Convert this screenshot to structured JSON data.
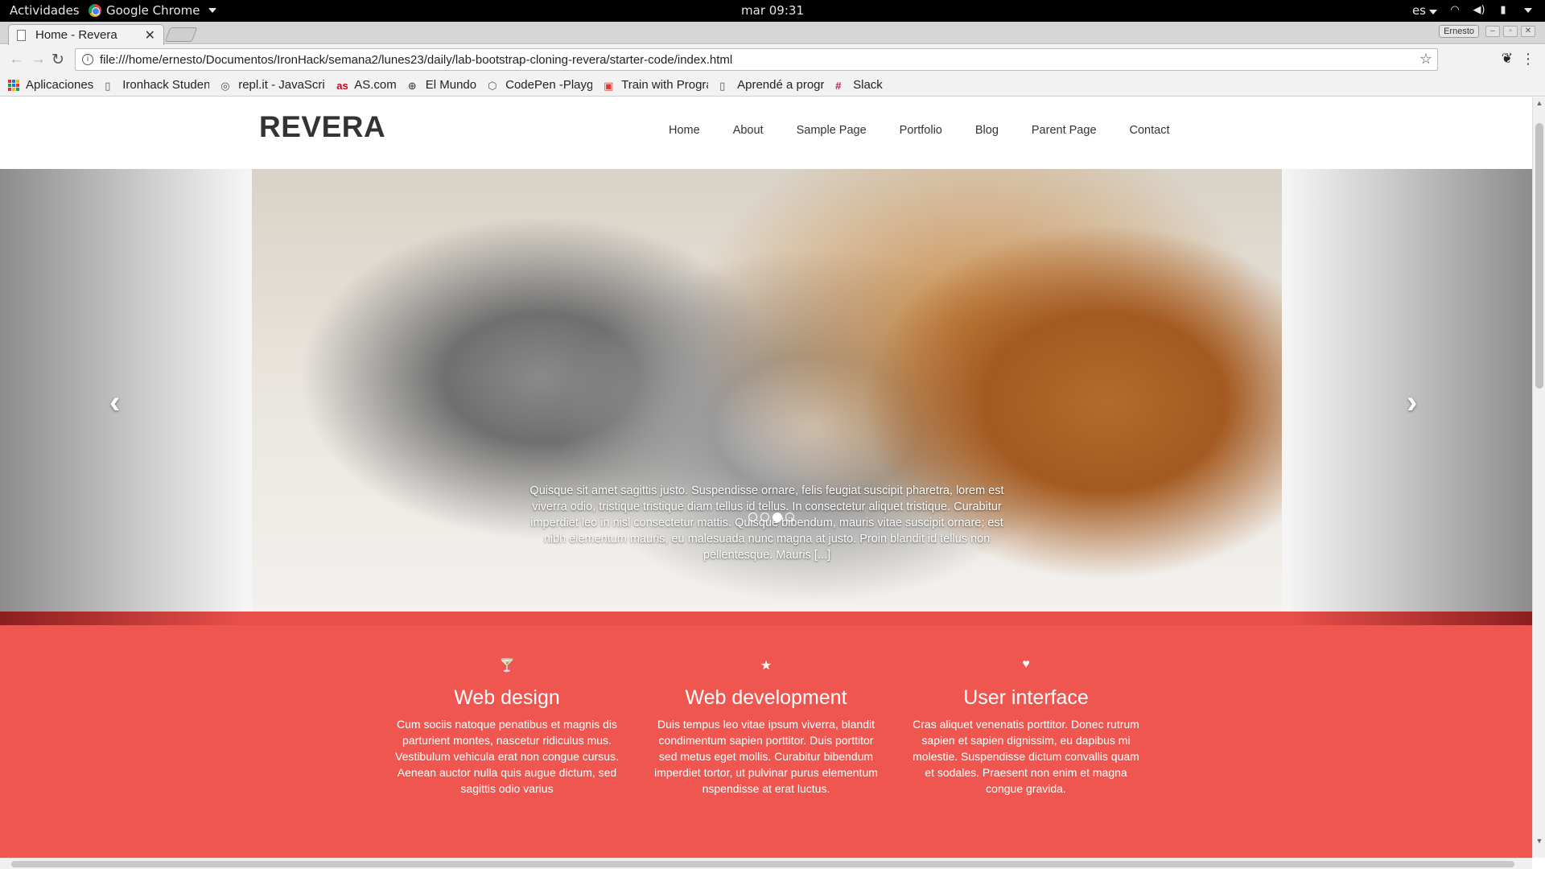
{
  "gnome": {
    "activities": "Actividades",
    "app_name": "Google Chrome",
    "clock": "mar 09:31",
    "lang": "es"
  },
  "browser": {
    "tab_title": "Home - Revera",
    "user": "Ernesto",
    "url": "file:///home/ernesto/Documentos/IronHack/semana2/lunes23/daily/lab-bootstrap-cloning-revera/starter-code/index.html",
    "bookmarks": [
      {
        "label": "Aplicaciones",
        "icon": "apps-grid-icon"
      },
      {
        "label": "Ironhack Student",
        "icon": "page-icon"
      },
      {
        "label": "repl.it - JavaScrip",
        "icon": "replit-icon"
      },
      {
        "label": "AS.com",
        "icon": "as-icon",
        "color": "#d0021b"
      },
      {
        "label": "El Mundo",
        "icon": "globe-icon"
      },
      {
        "label": "CodePen -Playgr",
        "icon": "codepen-icon"
      },
      {
        "label": "Train with Progra",
        "icon": "train-icon",
        "color": "#e53935"
      },
      {
        "label": "Aprendé a progra",
        "icon": "page-icon"
      },
      {
        "label": "Slack",
        "icon": "slack-icon",
        "color": "#c2185b"
      }
    ]
  },
  "site": {
    "logo": "REVERA",
    "nav": [
      "Home",
      "About",
      "Sample Page",
      "Portfolio",
      "Blog",
      "Parent Page",
      "Contact"
    ],
    "slider": {
      "caption": "Quisque sit amet sagittis justo. Suspendisse ornare, felis feugiat suscipit pharetra, lorem est viverra odio, tristique tristique diam tellus id tellus. In consectetur aliquet tristique. Curabitur imperdiet leo in nisl consectetur mattis. Quisque bibendum, mauris vitae suscipit ornare; est nibh elementum mauris, eu malesuada nunc magna at justo. Proin blandit id tellus non pellentesque. Mauris [...]",
      "indicator_count": 4,
      "active_indicator": 3,
      "prev": "‹",
      "next": "›"
    },
    "services": [
      {
        "icon": "glass-icon",
        "glyph": "🍸",
        "title": "Web design",
        "text": "Cum sociis natoque penatibus et magnis dis parturient montes, nascetur ridiculus mus. Vestibulum vehicula erat non congue cursus. Aenean auctor nulla quis augue dictum, sed sagittis odio varius"
      },
      {
        "icon": "star-icon",
        "glyph": "★",
        "title": "Web development",
        "text": "Duis tempus leo vitae ipsum viverra, blandit condimentum sapien porttitor. Duis porttitor sed metus eget mollis. Curabitur bibendum imperdiet tortor, ut pulvinar purus elementum nspendisse at erat luctus."
      },
      {
        "icon": "heart-icon",
        "glyph": "♥",
        "title": "User interface",
        "text": "Cras aliquet venenatis porttitor. Donec rutrum sapien et sapien dignissim, eu dapibus mi molestie. Suspendisse dictum convallis quam et sodales. Praesent non enim et magna congue gravida."
      }
    ],
    "accent_color": "#ef5650"
  }
}
